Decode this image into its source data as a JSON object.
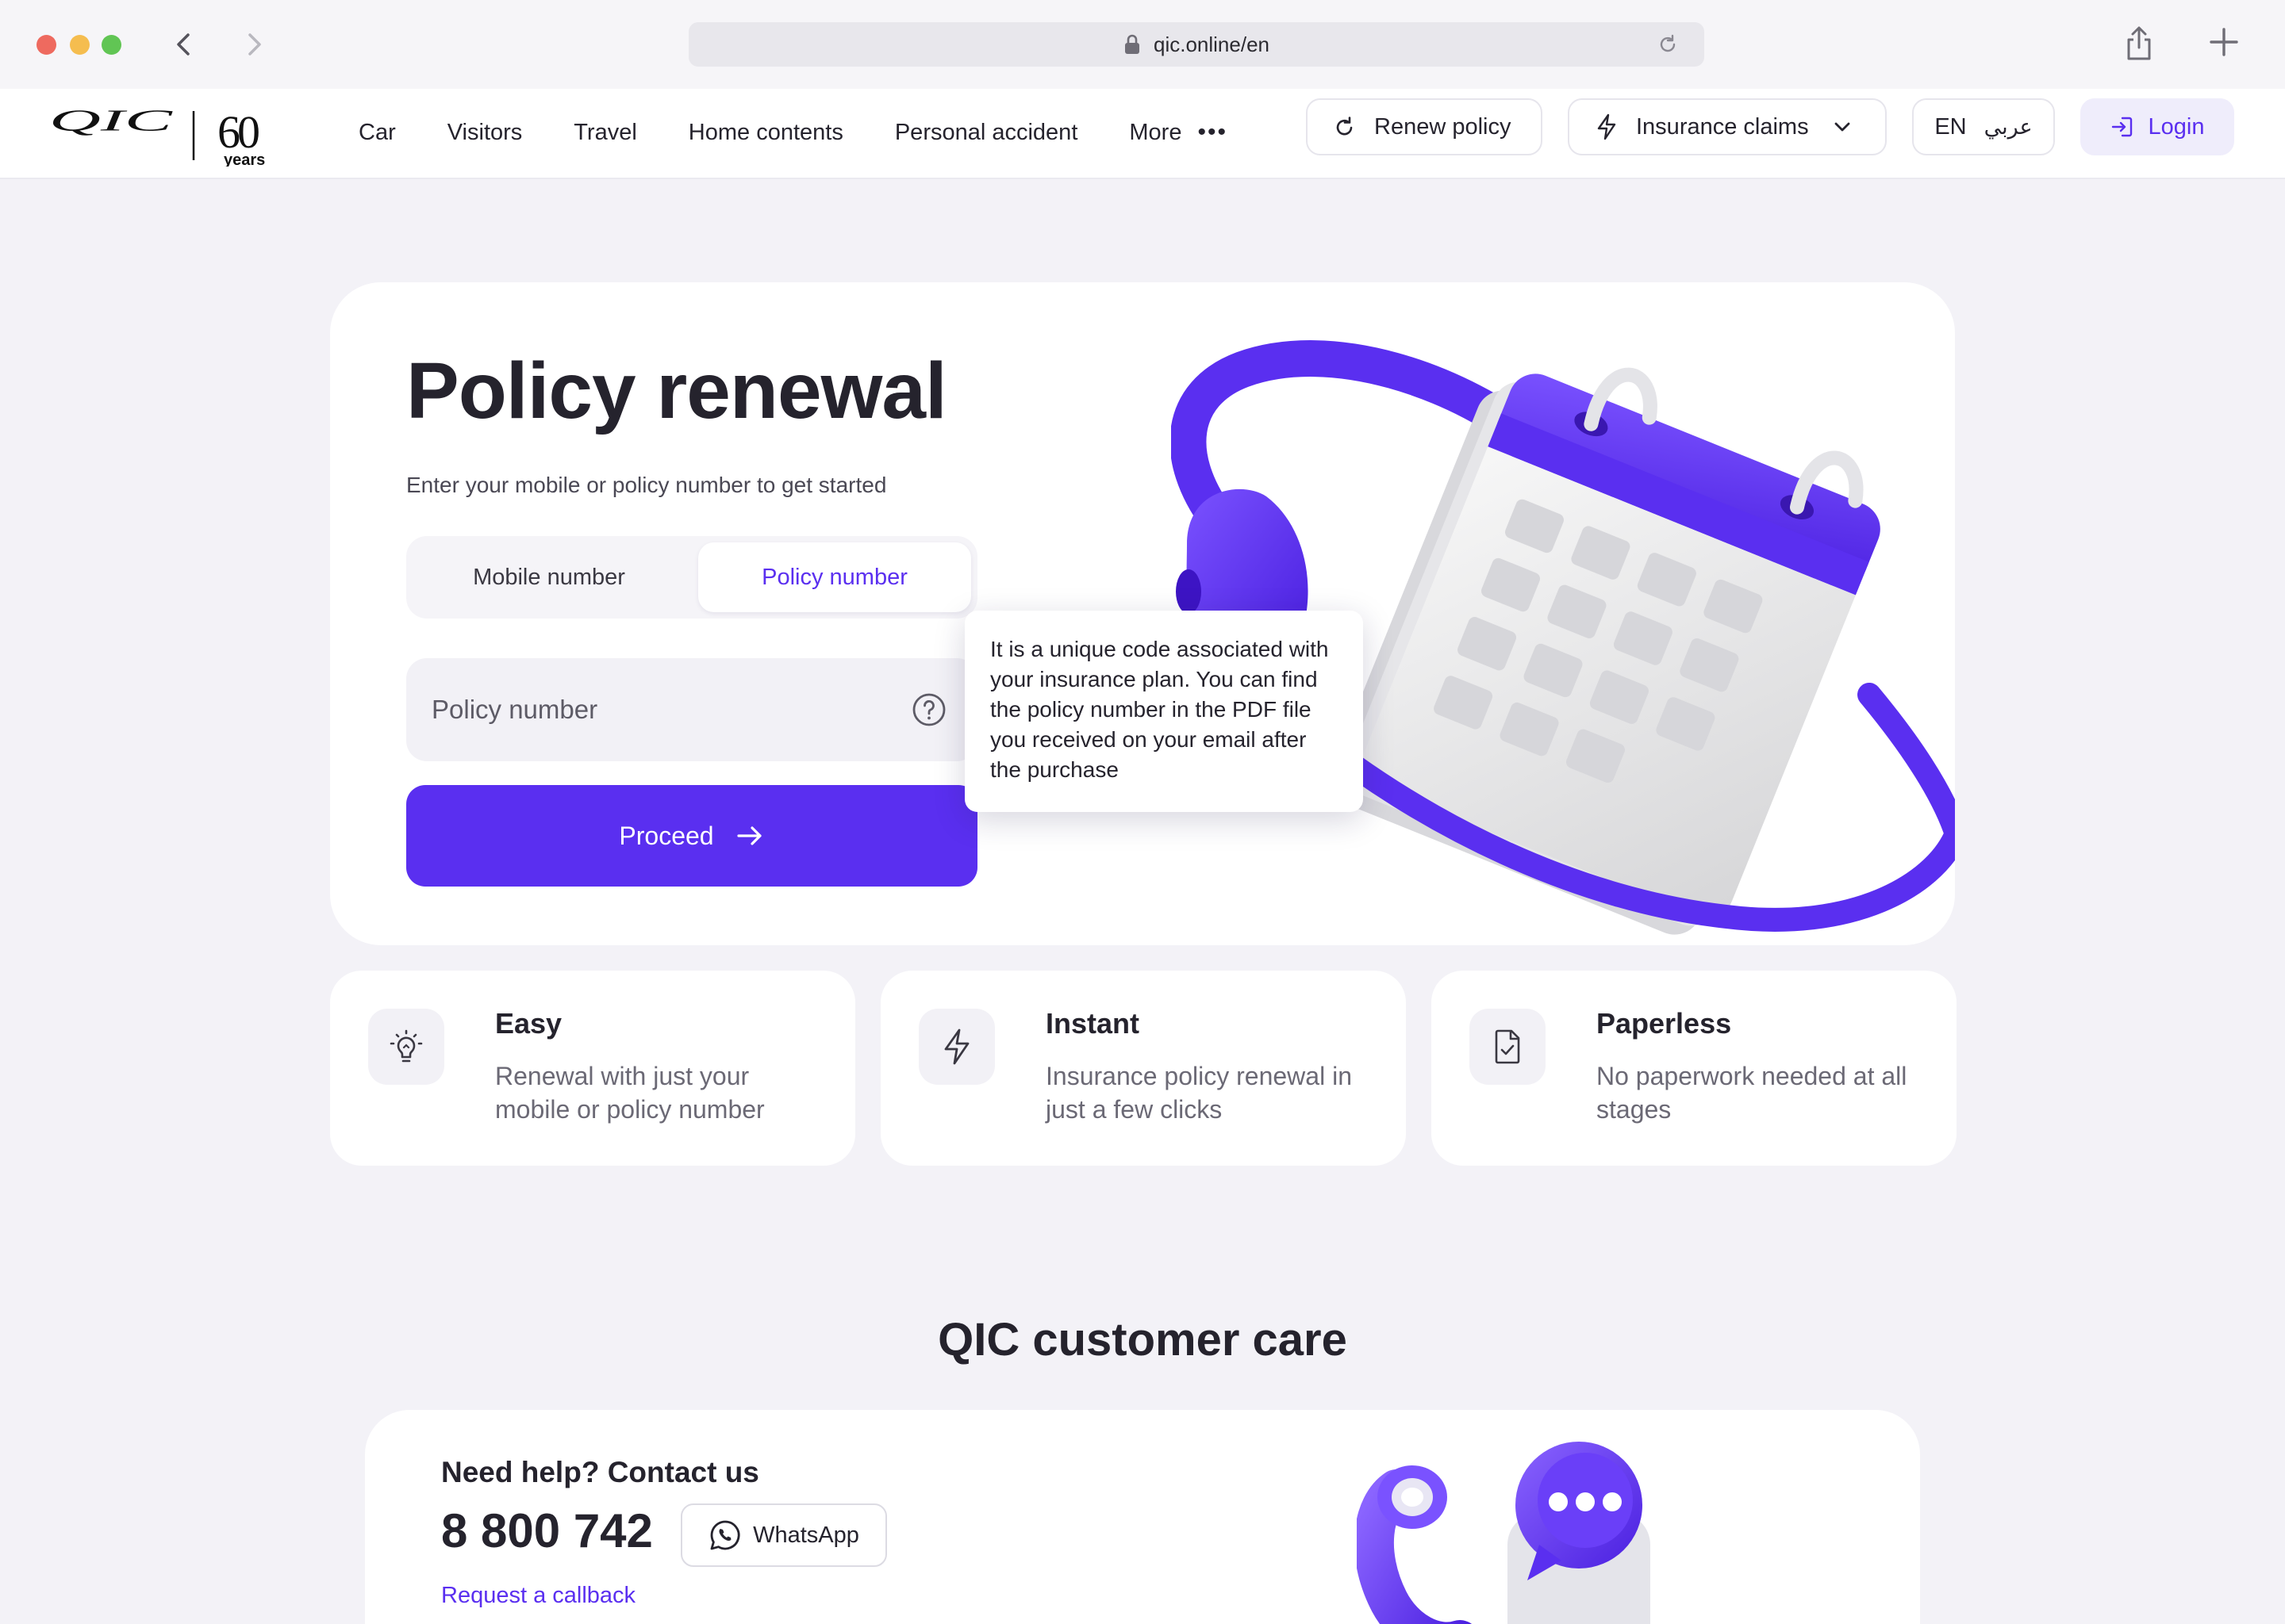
{
  "browser": {
    "url": "qic.online/en"
  },
  "header": {
    "logo_text": "QIC",
    "logo_badge_number": "60",
    "logo_badge_word": "years",
    "nav": [
      "Car",
      "Visitors",
      "Travel",
      "Home contents",
      "Personal accident"
    ],
    "more_label": "More",
    "renew_label": "Renew policy",
    "claims_label": "Insurance claims",
    "lang_en": "EN",
    "lang_ar": "عربي",
    "login_label": "Login"
  },
  "hero": {
    "title": "Policy renewal",
    "subtitle": "Enter your mobile or policy number to get started",
    "tabs": [
      "Mobile number",
      "Policy number"
    ],
    "active_tab": "Policy number",
    "input_placeholder": "Policy number",
    "input_value": "",
    "proceed_label": "Proceed",
    "tooltip": "It is a unique code associated with your insurance plan. You can find the policy number in the PDF file you received on your email after the purchase"
  },
  "features": [
    {
      "icon": "lightbulb-icon",
      "title": "Easy",
      "description": "Renewal with just your mobile or policy number"
    },
    {
      "icon": "lightning-icon",
      "title": "Instant",
      "description": "Insurance policy renewal in just a few clicks"
    },
    {
      "icon": "document-check-icon",
      "title": "Paperless",
      "description": "No paperwork needed at all stages"
    }
  ],
  "care": {
    "title": "QIC customer care",
    "help_heading": "Need help? Contact us",
    "phone": "8 800 742",
    "whatsapp_label": "WhatsApp",
    "callback_label": "Request a callback"
  },
  "colors": {
    "accent": "#5a2ff0",
    "page_bg": "#f3f2f7",
    "card_bg": "#ffffff",
    "text": "#25232d",
    "muted_text": "#6b6975"
  }
}
